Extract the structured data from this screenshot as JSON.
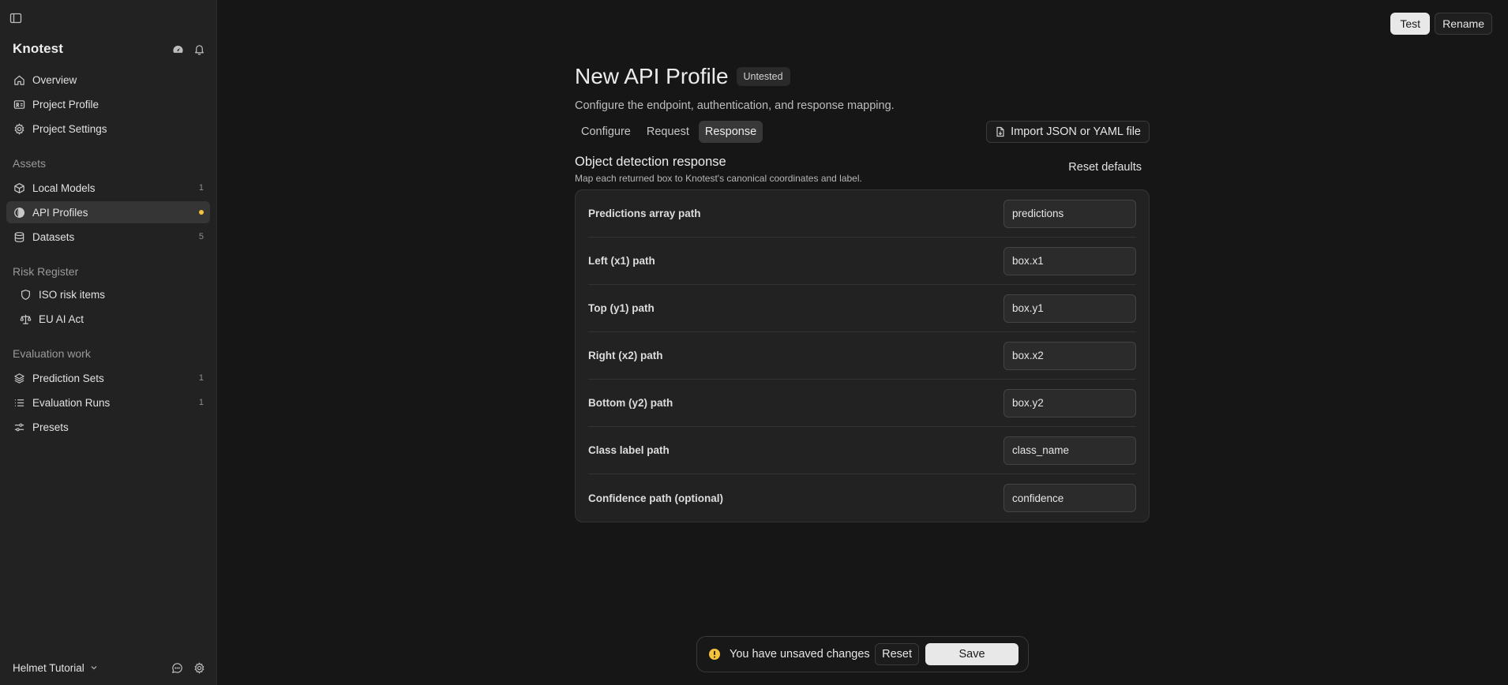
{
  "sidebar": {
    "brand": "Knotest",
    "toggle_icon": "sidebar-toggle-icon",
    "header_icons": [
      "dashboard-gauge-icon",
      "bell-icon"
    ],
    "top_items": [
      {
        "label": "Overview",
        "icon": "home-icon"
      },
      {
        "label": "Project Profile",
        "icon": "id-card-icon"
      },
      {
        "label": "Project Settings",
        "icon": "settings-cog-icon"
      }
    ],
    "assets": {
      "label": "Assets",
      "items": [
        {
          "label": "Local Models",
          "icon": "cube-icon",
          "count": "1"
        },
        {
          "label": "API Profiles",
          "icon": "api-globe-icon",
          "active": true,
          "indicator_color": "#f5c23e"
        },
        {
          "label": "Datasets",
          "icon": "database-icon",
          "count": "5"
        }
      ]
    },
    "risk_register": {
      "label": "Risk Register",
      "items": [
        {
          "label": "ISO risk items",
          "icon": "shield-icon"
        },
        {
          "label": "EU AI Act",
          "icon": "scales-icon"
        }
      ]
    },
    "evaluation": {
      "label": "Evaluation work",
      "items": [
        {
          "label": "Prediction Sets",
          "icon": "layers-icon",
          "count": "1"
        },
        {
          "label": "Evaluation Runs",
          "icon": "list-icon",
          "count": "1"
        },
        {
          "label": "Presets",
          "icon": "sliders-icon"
        }
      ]
    },
    "footer": {
      "workspace": "Helmet Tutorial",
      "icons": [
        "chat-bubble-icon",
        "gear-icon"
      ]
    }
  },
  "top_actions": {
    "test_label": "Test",
    "rename_label": "Rename"
  },
  "main": {
    "title": "New API Profile",
    "status_badge": "Untested",
    "subtitle": "Configure the endpoint, authentication, and response mapping.",
    "tabs": [
      {
        "label": "Configure",
        "active": false
      },
      {
        "label": "Request",
        "active": false
      },
      {
        "label": "Response",
        "active": true
      }
    ],
    "import_label": "Import JSON or YAML file",
    "section": {
      "title": "Object detection response",
      "description": "Map each returned box to Knotest's canonical coordinates and label.",
      "reset_defaults_label": "Reset defaults"
    },
    "fields": [
      {
        "label": "Predictions array path",
        "value": "predictions"
      },
      {
        "label": "Left (x1) path",
        "value": "box.x1"
      },
      {
        "label": "Top (y1) path",
        "value": "box.y1"
      },
      {
        "label": "Right (x2) path",
        "value": "box.x2"
      },
      {
        "label": "Bottom (y2) path",
        "value": "box.y2"
      },
      {
        "label": "Class label path",
        "value": "class_name"
      },
      {
        "label": "Confidence path (optional)",
        "value": "confidence"
      }
    ]
  },
  "unsaved_bar": {
    "message": "You have unsaved changes",
    "reset_label": "Reset",
    "save_label": "Save",
    "warning_color": "#f5c23e"
  },
  "colors": {
    "background": "#161616",
    "sidebar": "#222222",
    "accent_indicator": "#f5c23e"
  }
}
